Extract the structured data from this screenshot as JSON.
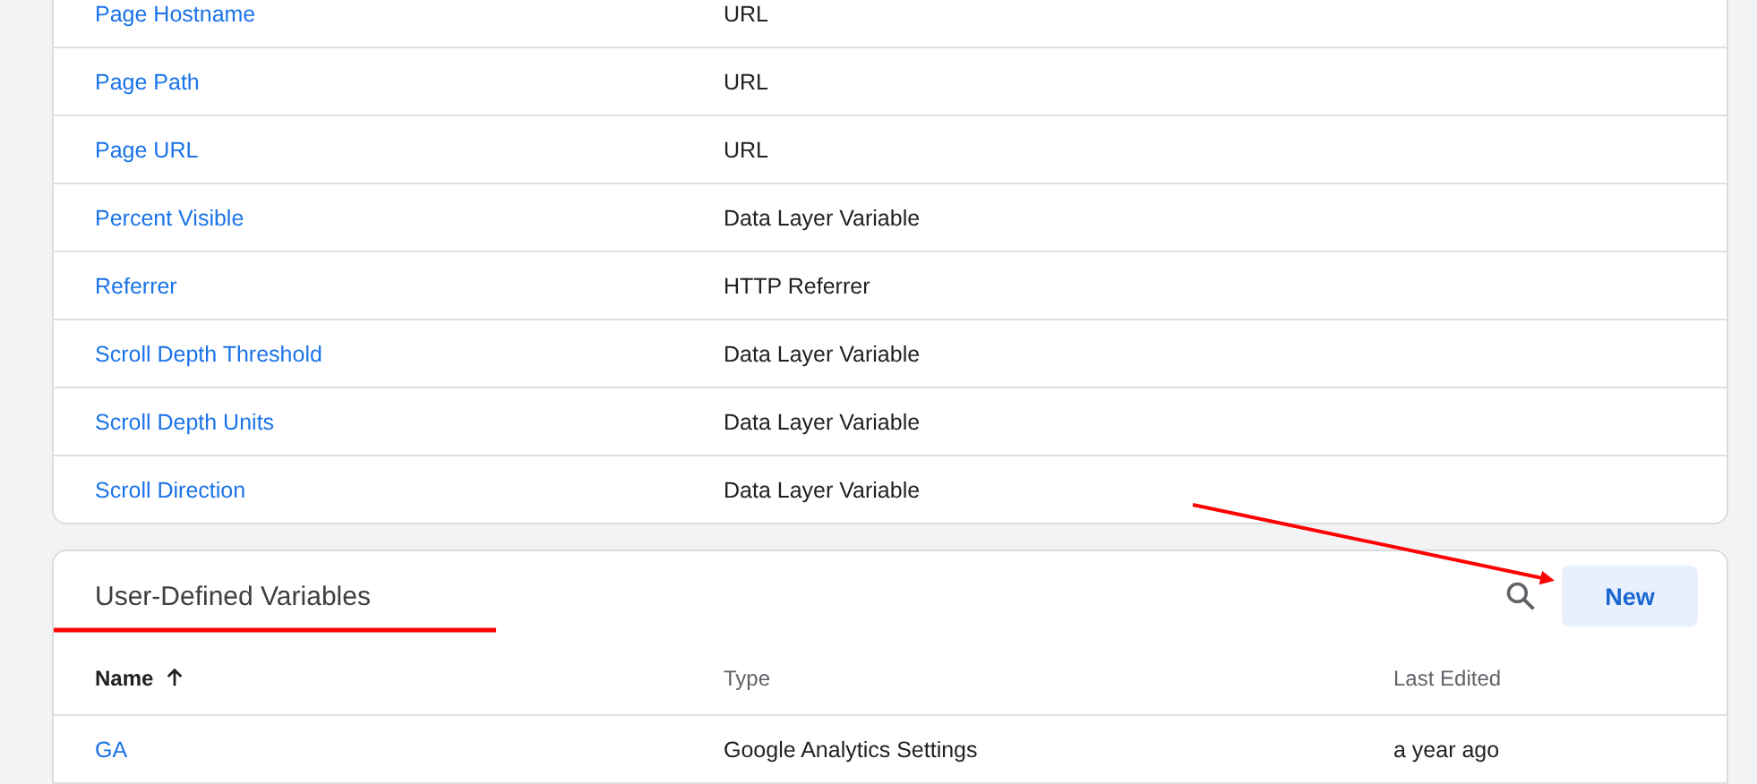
{
  "built_in_variables": {
    "rows": [
      {
        "name": "Page Hostname",
        "type": "URL"
      },
      {
        "name": "Page Path",
        "type": "URL"
      },
      {
        "name": "Page URL",
        "type": "URL"
      },
      {
        "name": "Percent Visible",
        "type": "Data Layer Variable"
      },
      {
        "name": "Referrer",
        "type": "HTTP Referrer"
      },
      {
        "name": "Scroll Depth Threshold",
        "type": "Data Layer Variable"
      },
      {
        "name": "Scroll Depth Units",
        "type": "Data Layer Variable"
      },
      {
        "name": "Scroll Direction",
        "type": "Data Layer Variable"
      }
    ]
  },
  "user_defined_variables": {
    "title": "User-Defined Variables",
    "new_button": "New",
    "columns": [
      {
        "label": "Name",
        "sorted": true
      },
      {
        "label": "Type",
        "sorted": false
      },
      {
        "label": "Last Edited",
        "sorted": false
      }
    ],
    "rows": [
      {
        "name": "GA",
        "type": "Google Analytics Settings",
        "last_edited": "a year ago"
      }
    ]
  }
}
